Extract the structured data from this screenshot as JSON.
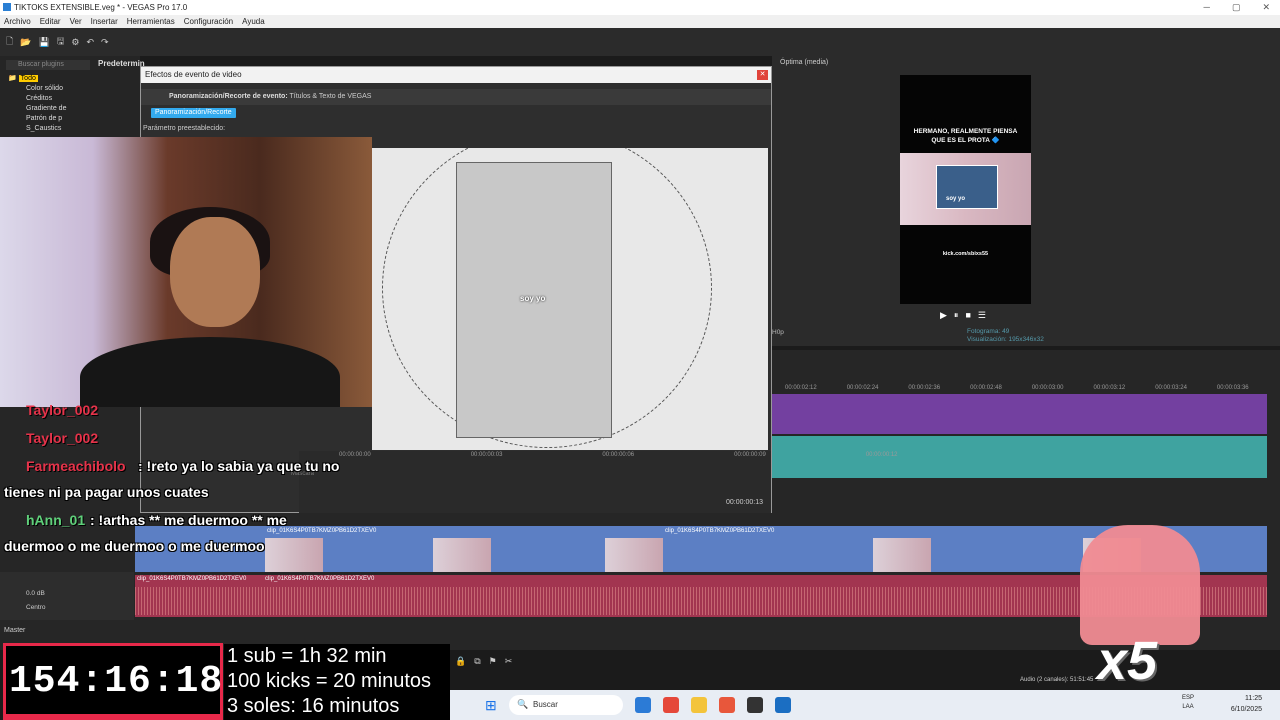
{
  "window": {
    "title": "TIKTOKS EXTENSIBLE.veg * - VEGAS Pro 17.0",
    "controls": [
      "─",
      "▢",
      "✕"
    ]
  },
  "menu": [
    "Archivo",
    "Editar",
    "Ver",
    "Insertar",
    "Herramientas",
    "Configuración",
    "Ayuda"
  ],
  "left_panel": {
    "search_placeholder": "Buscar plugins",
    "preset_tab": "Predetermin",
    "tree": [
      "Todo",
      "Color sólido",
      "Créditos",
      "Gradiente de",
      "Patrón de p",
      "S_Caustics"
    ]
  },
  "dialog": {
    "title": "Efectos de evento de video",
    "close": "✕",
    "fx_label": "Panoramización/Recorte de evento:",
    "fx_value": "Títulos & Texto de VEGAS",
    "chip": "Panoramización/Recorte",
    "param_label": "Parámetro preestablecido:",
    "canvas_text": "soy yo",
    "ruler": [
      "00:00:00:00",
      "00:00:00:03",
      "00:00:00:06",
      "00:00:00:09",
      "00:00:00:12"
    ],
    "mask_label": "Máscara",
    "time": "00:00:00:13"
  },
  "preview": {
    "header_label": "Óptima (media)",
    "phone_text": "HERMANO, REALMENTE PIENSA QUE ES EL PROTA 🔷",
    "phone_caption": "soy yo",
    "phone_link": "kick.com/sbixs55",
    "controls": [
      "▶",
      "⏸",
      "■",
      "☰"
    ],
    "frame_label": "Fotograma:",
    "frame_value": "49",
    "display_label": "Visualización:",
    "display_value": "195x346x32",
    "left_line1": "H0p",
    "left_line2": "rcortadora"
  },
  "timeline": {
    "ruler": [
      "00:00:02:12",
      "00:00:02:24",
      "00:00:02:36",
      "00:00:02:48",
      "00:00:03:00",
      "00:00:03:12",
      "00:00:03:24",
      "00:00:03:36"
    ],
    "video_clip": "clip_01K6S4P0TB7KMZ0PB61D2TXEV0",
    "audio_clip": "clip_01K6S4P0TB7KMZ0PB61D2TXEV0",
    "volume": "0.0 dB",
    "pan": "Centro",
    "master": "Master",
    "status": "Audio (2 canales): 51:51:45"
  },
  "chat": [
    {
      "user": "Taylor_002",
      "message": ""
    },
    {
      "user": "Taylor_002",
      "message": ""
    },
    {
      "user": "Farmeachibolo",
      "message": ": !reto ya lo sabia ya que tu no"
    },
    {
      "user": "",
      "message": "tienes ni pa pagar unos cuates"
    },
    {
      "user": "hAnn_01",
      "message": ": !arthas ** me duermoo ** me"
    },
    {
      "user": "",
      "message": "duermoo o me duermoo o me duermoo"
    }
  ],
  "overlay": {
    "timer": "154:16:18",
    "subs": [
      "1 sub = 1h 32 min",
      "100 kicks = 20 minutos",
      "3 soles: 16 minutos"
    ],
    "multiplier": "x5"
  },
  "taskbar": {
    "search": "Buscar",
    "lang1": "ESP",
    "lang2": "LAA",
    "time": "11:25",
    "date": "6/10/2025"
  },
  "colors": {
    "accent": "#33aaee",
    "timer_border": "#e8294a",
    "chat_name": "#e6334a"
  }
}
